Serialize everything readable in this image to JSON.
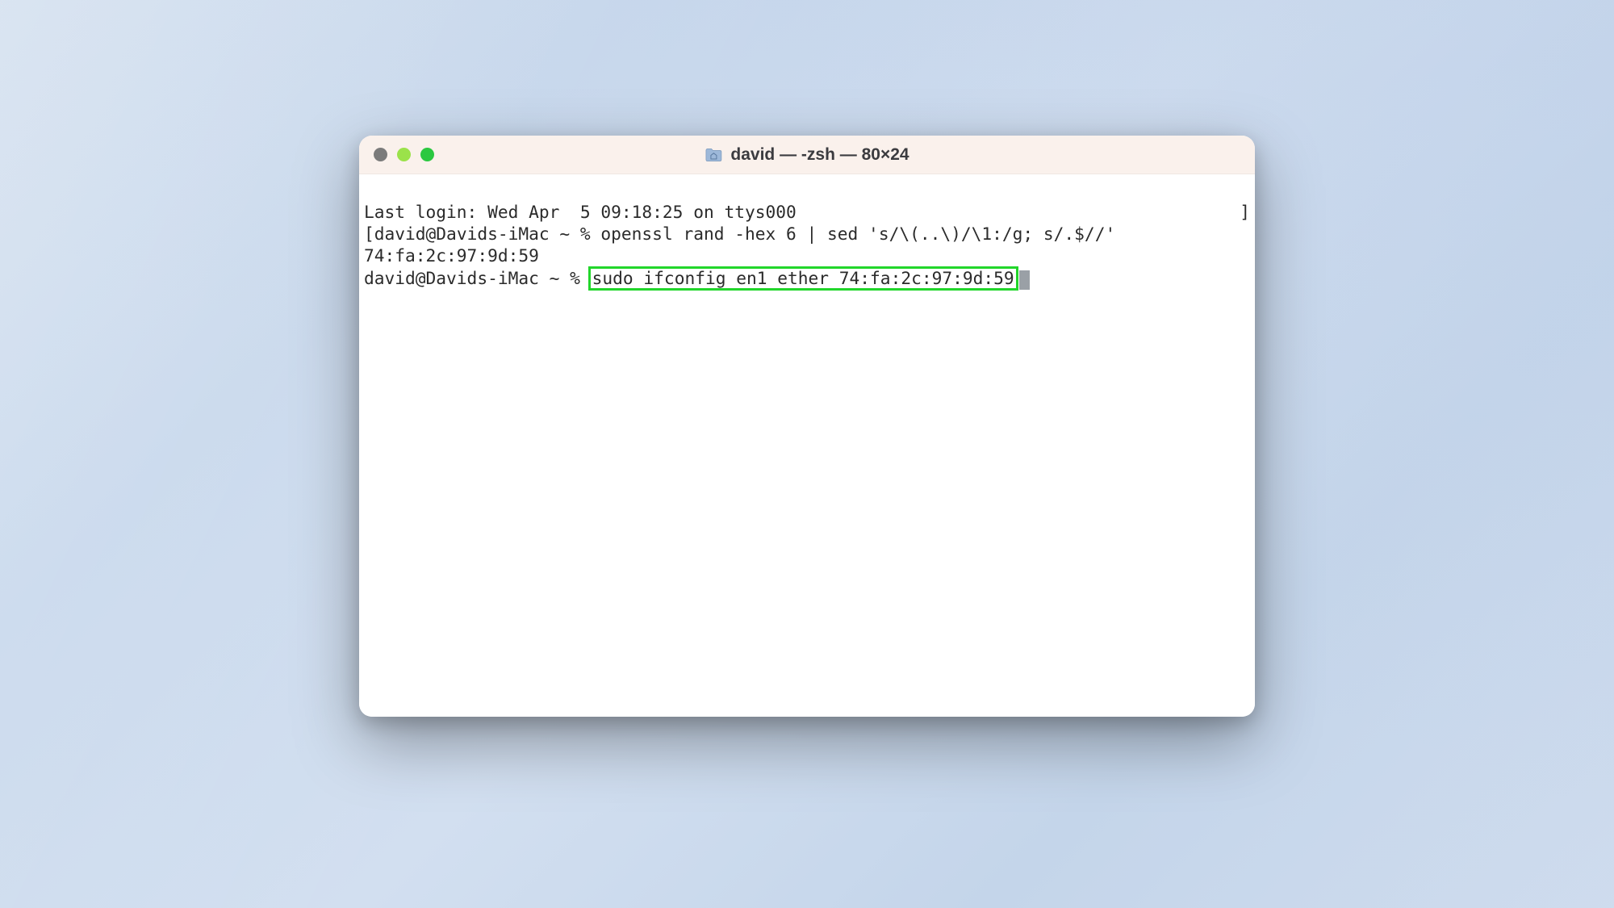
{
  "window": {
    "title": "david — -zsh — 80×24"
  },
  "terminal": {
    "last_login": "Last login: Wed Apr  5 09:18:25 on ttys000",
    "prompt1_open": "[",
    "prompt1": "david@Davids-iMac ~ % ",
    "cmd1": "openssl rand -hex 6 | sed 's/\\(..\\)/\\1:/g; s/.$//'",
    "prompt1_close": "]",
    "output1": "74:fa:2c:97:9d:59",
    "prompt2": "david@Davids-iMac ~ % ",
    "cmd2": "sudo ifconfig en1 ether 74:fa:2c:97:9d:59"
  }
}
